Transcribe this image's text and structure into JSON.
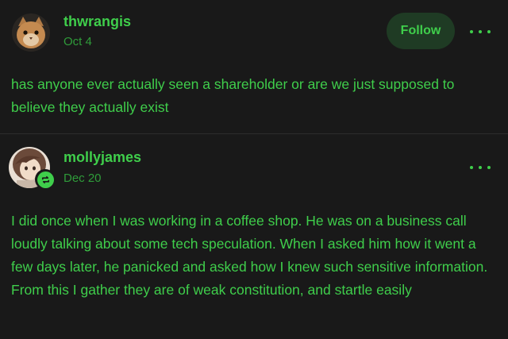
{
  "posts": [
    {
      "username": "thwrangis",
      "date": "Oct 4",
      "follow_label": "Follow",
      "text": "has anyone ever actually seen a shareholder or are we just supposed to believe they actually exist"
    },
    {
      "username": "mollyjames",
      "date": "Dec 20",
      "text": "I did once when I was working in a coffee shop. He was on a business call loudly talking about some tech speculation. When I asked him how it went a few days later, he panicked and asked how I knew such sensitive information. From this I gather they are of weak constitution, and startle easily"
    }
  ],
  "colors": {
    "background": "#191919",
    "accent": "#3fce4b",
    "date": "#2f9c3a",
    "follow_bg": "#1f3b24"
  },
  "icons": {
    "more": "more-options-icon",
    "reblog": "reblog-icon"
  }
}
